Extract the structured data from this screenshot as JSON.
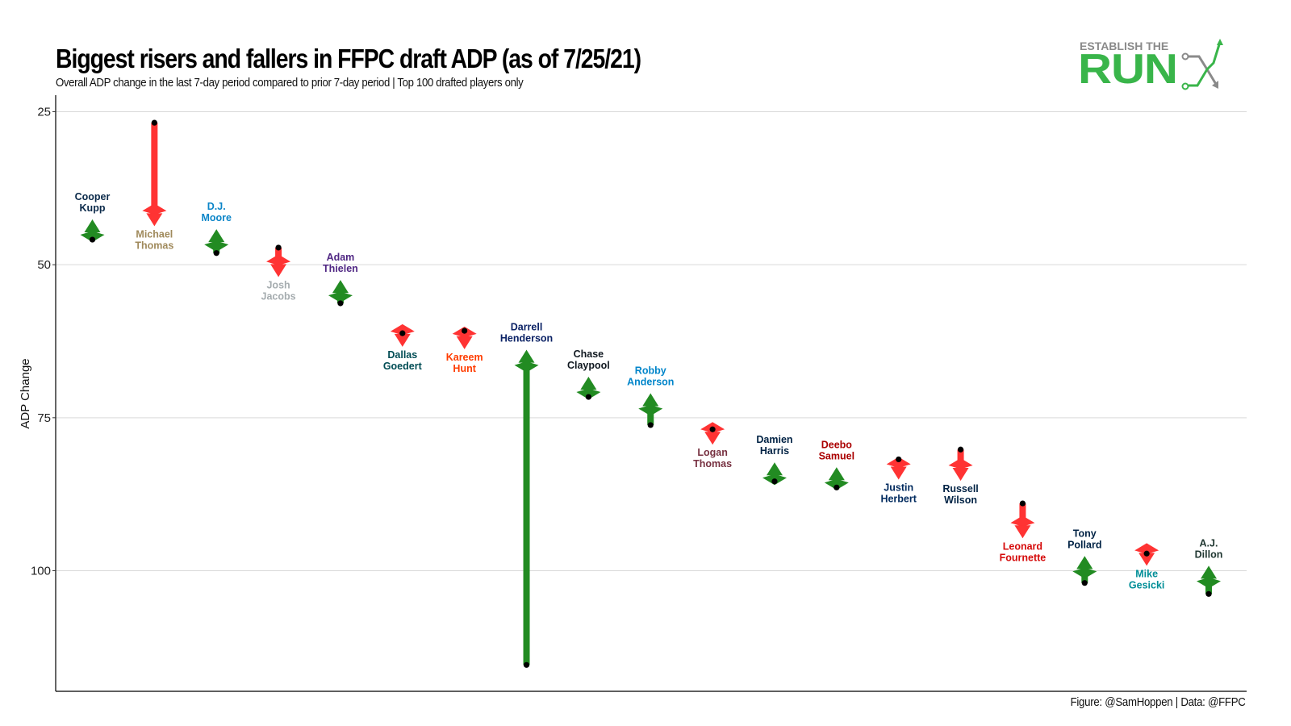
{
  "header": {
    "title": "Biggest risers and fallers in FFPC draft ADP (as of 7/25/21)",
    "subtitle": "Overall ADP change in the last 7-day period compared to prior 7-day period | Top 100 drafted players only"
  },
  "logo": {
    "line1": "ESTABLISH THE",
    "line2": "RUN",
    "icon": "chart-arrows-icon",
    "colors": {
      "green": "#39b54a",
      "gray": "#8a8a8a"
    }
  },
  "caption": "Figure: @SamHoppen | Data: @FFPC",
  "colors": {
    "riser": "#228b22",
    "faller": "#ff3333",
    "dot": "#000000",
    "grid": "#d9d9d9",
    "axis": "#000000"
  },
  "chart_data": {
    "type": "arrow",
    "title": "Biggest risers and fallers in FFPC draft ADP (as of 7/25/21)",
    "subtitle": "Overall ADP change in the last 7-day period compared to prior 7-day period | Top 100 drafted players only",
    "xlabel": "",
    "ylabel": "ADP Change",
    "ylim": [
      121,
      23
    ],
    "y_reversed": true,
    "yticks": [
      25,
      50,
      75,
      100
    ],
    "grid": "horizontal-major",
    "legend": "none",
    "points": [
      {
        "name": "Cooper Kupp",
        "label_lines": [
          "Cooper",
          "Kupp"
        ],
        "adp_prior": 45.9,
        "adp_current": 42.6,
        "label_color": "#0b2a4a"
      },
      {
        "name": "Michael Thomas",
        "label_lines": [
          "Michael",
          "Thomas"
        ],
        "adp_prior": 26.8,
        "adp_current": 43.7,
        "label_color": "#a08a5c"
      },
      {
        "name": "D.J. Moore",
        "label_lines": [
          "D.J.",
          "Moore"
        ],
        "adp_prior": 48.1,
        "adp_current": 44.2,
        "label_color": "#0c85c8"
      },
      {
        "name": "Josh Jacobs",
        "label_lines": [
          "Josh",
          "Jacobs"
        ],
        "adp_prior": 47.2,
        "adp_current": 52.0,
        "label_color": "#a5acaf"
      },
      {
        "name": "Adam Thielen",
        "label_lines": [
          "Adam",
          "Thielen"
        ],
        "adp_prior": 56.3,
        "adp_current": 52.5,
        "label_color": "#4f2683"
      },
      {
        "name": "Dallas Goedert",
        "label_lines": [
          "Dallas",
          "Goedert"
        ],
        "adp_prior": 61.2,
        "adp_current": 63.4,
        "label_color": "#004c54"
      },
      {
        "name": "Kareem Hunt",
        "label_lines": [
          "Kareem",
          "Hunt"
        ],
        "adp_prior": 60.8,
        "adp_current": 63.8,
        "label_color": "#ff3c00"
      },
      {
        "name": "Darrell Henderson",
        "label_lines": [
          "Darrell",
          "Henderson"
        ],
        "adp_prior": 115.4,
        "adp_current": 63.9,
        "label_color": "#0b2265"
      },
      {
        "name": "Chase Claypool",
        "label_lines": [
          "Chase",
          "Claypool"
        ],
        "adp_prior": 71.6,
        "adp_current": 68.3,
        "label_color": "#101820"
      },
      {
        "name": "Robby Anderson",
        "label_lines": [
          "Robby",
          "Anderson"
        ],
        "adp_prior": 76.2,
        "adp_current": 71.0,
        "label_color": "#0085ca"
      },
      {
        "name": "Logan Thomas",
        "label_lines": [
          "Logan",
          "Thomas"
        ],
        "adp_prior": 76.9,
        "adp_current": 79.4,
        "label_color": "#773141"
      },
      {
        "name": "Damien Harris",
        "label_lines": [
          "Damien",
          "Harris"
        ],
        "adp_prior": 85.4,
        "adp_current": 82.3,
        "label_color": "#002244"
      },
      {
        "name": "Deebo Samuel",
        "label_lines": [
          "Deebo",
          "Samuel"
        ],
        "adp_prior": 86.4,
        "adp_current": 83.1,
        "label_color": "#aa0000"
      },
      {
        "name": "Justin Herbert",
        "label_lines": [
          "Justin",
          "Herbert"
        ],
        "adp_prior": 81.8,
        "adp_current": 85.1,
        "label_color": "#002a5e"
      },
      {
        "name": "Russell Wilson",
        "label_lines": [
          "Russell",
          "Wilson"
        ],
        "adp_prior": 80.2,
        "adp_current": 85.3,
        "label_color": "#002244"
      },
      {
        "name": "Leonard Fournette",
        "label_lines": [
          "Leonard",
          "Fournette"
        ],
        "adp_prior": 89.0,
        "adp_current": 94.7,
        "label_color": "#d50a0a"
      },
      {
        "name": "Tony Pollard",
        "label_lines": [
          "Tony",
          "Pollard"
        ],
        "adp_prior": 102.0,
        "adp_current": 97.6,
        "label_color": "#002244"
      },
      {
        "name": "Mike Gesicki",
        "label_lines": [
          "Mike",
          "Gesicki"
        ],
        "adp_prior": 97.2,
        "adp_current": 99.2,
        "label_color": "#008e97"
      },
      {
        "name": "A.J. Dillon",
        "label_lines": [
          "A.J.",
          "Dillon"
        ],
        "adp_prior": 103.8,
        "adp_current": 99.2,
        "label_color": "#203731"
      }
    ]
  }
}
